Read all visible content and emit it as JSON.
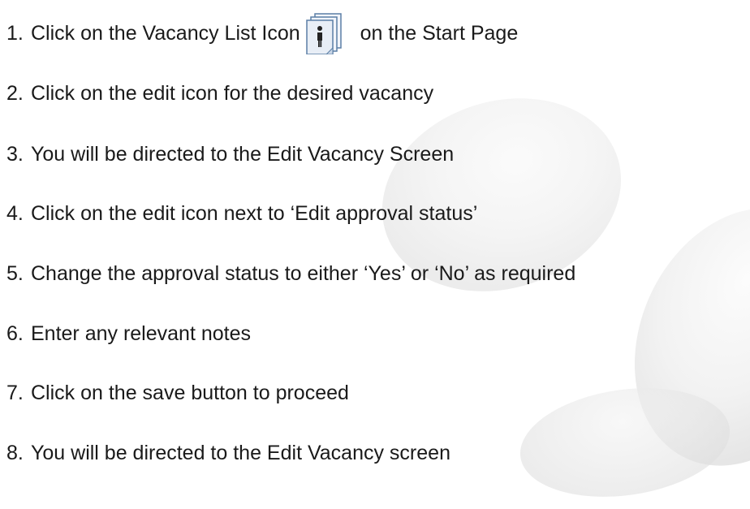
{
  "steps": [
    {
      "number": "1.",
      "text_before_icon": "Click on the Vacancy List Icon",
      "text_after_icon": "on the Start Page",
      "icon": "vacancy-list-icon"
    },
    {
      "number": "2.",
      "text": "Click on the edit icon for the desired vacancy"
    },
    {
      "number": "3.",
      "text": "You will be directed to the Edit Vacancy Screen"
    },
    {
      "number": "4.",
      "text": "Click on the edit icon next to ‘Edit approval status’"
    },
    {
      "number": "5.",
      "text": "Change the approval status to either ‘Yes’ or ‘No’ as required"
    },
    {
      "number": "6.",
      "text": "Enter any relevant notes"
    },
    {
      "number": "7.",
      "text": "Click on the save button to proceed"
    },
    {
      "number": "8.",
      "text": "You will be directed to the Edit Vacancy screen"
    }
  ],
  "colors": {
    "text": "#1a1a1a",
    "icon_frame": "#5b7fa6",
    "icon_fill": "#e8eef6"
  }
}
